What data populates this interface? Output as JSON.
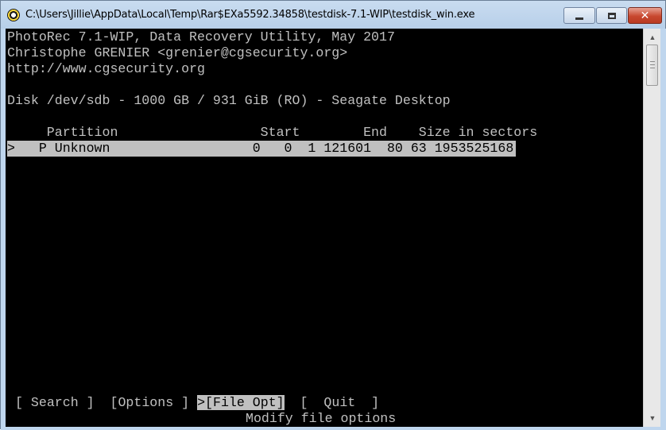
{
  "window": {
    "title": "C:\\Users\\Jillie\\AppData\\Local\\Temp\\Rar$EXa5592.34858\\testdisk-7.1-WIP\\testdisk_win.exe",
    "minimize_icon": "minimize-icon",
    "maximize_icon": "maximize-icon",
    "close_icon": "close-icon",
    "close_glyph": "✕"
  },
  "header": {
    "line1": "PhotoRec 7.1-WIP, Data Recovery Utility, May 2017",
    "line2": "Christophe GRENIER <grenier@cgsecurity.org>",
    "line3": "http://www.cgsecurity.org"
  },
  "disk": {
    "info": "Disk /dev/sdb - 1000 GB / 931 GiB (RO) - Seagate Desktop"
  },
  "table": {
    "header": "     Partition                  Start        End    Size in sectors",
    "rows": [
      {
        "text": ">   P Unknown                  0   0  1 121601  80 63 1953525168"
      }
    ]
  },
  "menu": {
    "items": [
      {
        "label": "[ Search ]",
        "active": false
      },
      {
        "label": "[Options ]",
        "active": false
      },
      {
        "label": ">[File Opt]",
        "active": true
      },
      {
        "label": "[  Quit  ]",
        "active": false
      }
    ],
    "hint": "Modify file options"
  },
  "scrollbar": {
    "up_icon": "▲",
    "down_icon": "▼"
  }
}
